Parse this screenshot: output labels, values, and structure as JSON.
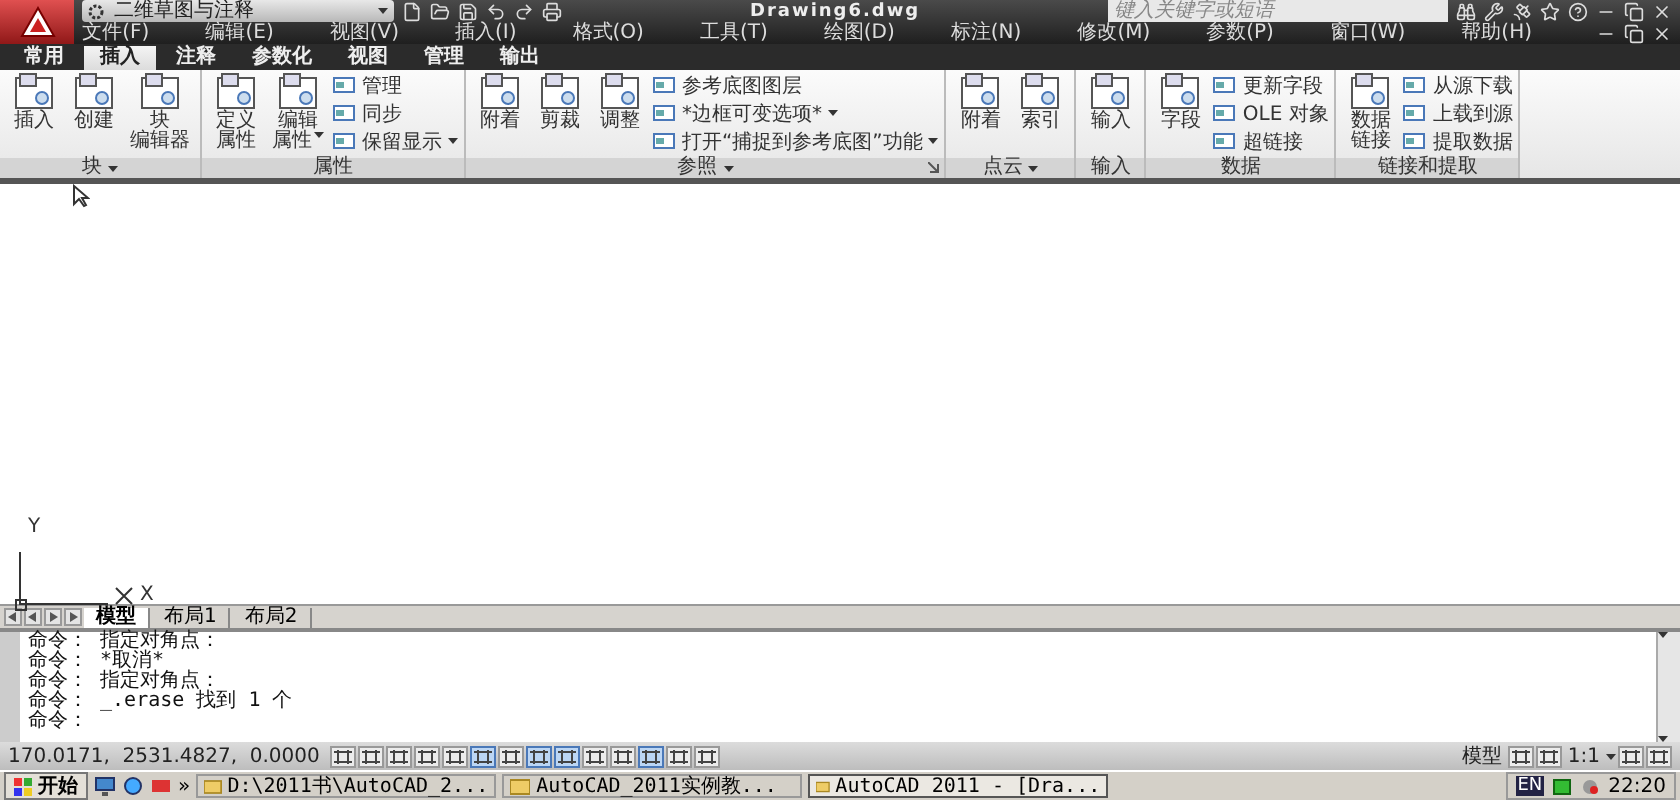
{
  "title_bar": {
    "workspace": "二维草图与注释",
    "document_title": "Drawing6.dwg",
    "search": {
      "placeholder": "键入关键字或短语"
    }
  },
  "menu": [
    "文件(F)",
    "编辑(E)",
    "视图(V)",
    "插入(I)",
    "格式(O)",
    "工具(T)",
    "绘图(D)",
    "标注(N)",
    "修改(M)",
    "参数(P)",
    "窗口(W)",
    "帮助(H)"
  ],
  "ribbon_tabs": [
    {
      "label": "常用",
      "selected": false
    },
    {
      "label": "插入",
      "selected": true
    },
    {
      "label": "注释",
      "selected": false
    },
    {
      "label": "参数化",
      "selected": false
    },
    {
      "label": "视图",
      "selected": false
    },
    {
      "label": "管理",
      "selected": false
    },
    {
      "label": "输出",
      "selected": false
    }
  ],
  "panels": [
    {
      "title": "块",
      "has_menu": true,
      "has_launcher": false,
      "items": [
        {
          "kind": "large",
          "label_lines": [
            "插入"
          ],
          "has_menu": false
        },
        {
          "kind": "large",
          "label_lines": [
            "创建"
          ],
          "has_menu": false
        },
        {
          "kind": "large",
          "label_lines": [
            "块",
            "编辑器"
          ],
          "has_menu": false
        }
      ]
    },
    {
      "title": "属性",
      "has_menu": false,
      "has_launcher": false,
      "items": [
        {
          "kind": "large",
          "label_lines": [
            "定义",
            "属性"
          ],
          "has_menu": false
        },
        {
          "kind": "large",
          "label_lines": [
            "编辑",
            "属性"
          ],
          "has_menu": true
        },
        {
          "kind": "small",
          "label": "管理",
          "has_menu": false
        },
        {
          "kind": "small",
          "label": "同步",
          "has_menu": false
        },
        {
          "kind": "small",
          "label": "保留显示",
          "has_menu": true
        }
      ]
    },
    {
      "title": "参照",
      "has_menu": true,
      "has_launcher": true,
      "items": [
        {
          "kind": "large",
          "label_lines": [
            "附着"
          ],
          "has_menu": false
        },
        {
          "kind": "large",
          "label_lines": [
            "剪裁"
          ],
          "has_menu": false
        },
        {
          "kind": "large",
          "label_lines": [
            "调整"
          ],
          "has_menu": false
        },
        {
          "kind": "small",
          "label": "参考底图图层",
          "has_menu": false
        },
        {
          "kind": "small",
          "label": "*边框可变选项*",
          "has_menu": true
        },
        {
          "kind": "small",
          "label": "打开“捕捉到参考底图”功能",
          "has_menu": true
        }
      ]
    },
    {
      "title": "点云",
      "has_menu": true,
      "has_launcher": false,
      "items": [
        {
          "kind": "large",
          "label_lines": [
            "附着"
          ],
          "has_menu": false
        },
        {
          "kind": "large",
          "label_lines": [
            "索引"
          ],
          "has_menu": false
        }
      ]
    },
    {
      "title": "输入",
      "has_menu": false,
      "has_launcher": false,
      "items": [
        {
          "kind": "large",
          "label_lines": [
            "输入"
          ],
          "has_menu": false
        }
      ]
    },
    {
      "title": "数据",
      "has_menu": false,
      "has_launcher": false,
      "items": [
        {
          "kind": "large",
          "label_lines": [
            "字段"
          ],
          "has_menu": false
        },
        {
          "kind": "small",
          "label": "更新字段",
          "has_menu": false
        },
        {
          "kind": "small",
          "label": "OLE 对象",
          "has_menu": false
        },
        {
          "kind": "small",
          "label": "超链接",
          "has_menu": false
        }
      ]
    },
    {
      "title": "链接和提取",
      "has_menu": false,
      "has_launcher": false,
      "items": [
        {
          "kind": "large",
          "label_lines": [
            "数据",
            "链接"
          ],
          "has_menu": false
        },
        {
          "kind": "small",
          "label": "从源下载",
          "has_menu": false
        },
        {
          "kind": "small",
          "label": "上载到源",
          "has_menu": false
        },
        {
          "kind": "small",
          "label": "提取数据",
          "has_menu": false
        }
      ]
    }
  ],
  "ucs": {
    "x_label": "X",
    "y_label": "Y"
  },
  "layout_tabs": [
    {
      "label": "模型",
      "selected": true
    },
    {
      "label": "布局1",
      "selected": false
    },
    {
      "label": "布局2",
      "selected": false
    }
  ],
  "command_lines": [
    "命令： 指定对角点：",
    "命令： *取消*",
    "命令： 指定对角点：",
    "命令： _.erase 找到 1 个",
    "命令："
  ],
  "status_bar": {
    "coordinates": "170.0171,  2531.4827,  0.0000",
    "toggles": [
      {
        "on": false
      },
      {
        "on": false
      },
      {
        "on": false
      },
      {
        "on": false
      },
      {
        "on": false
      },
      {
        "on": true
      },
      {
        "on": false
      },
      {
        "on": true
      },
      {
        "on": true
      },
      {
        "on": false
      },
      {
        "on": false
      },
      {
        "on": true
      },
      {
        "on": false
      },
      {
        "on": false
      }
    ],
    "space": "模型",
    "annotation_scale": "1:1"
  },
  "taskbar": {
    "start": "开始",
    "more": "»",
    "tasks": [
      {
        "label": "D:\\2011书\\AutoCAD_2...",
        "selected": false
      },
      {
        "label": "AutoCAD_2011实例教...",
        "selected": false
      },
      {
        "label": "AutoCAD 2011 - [Dra...",
        "selected": true
      }
    ],
    "language": "EN",
    "clock": "22:20"
  }
}
